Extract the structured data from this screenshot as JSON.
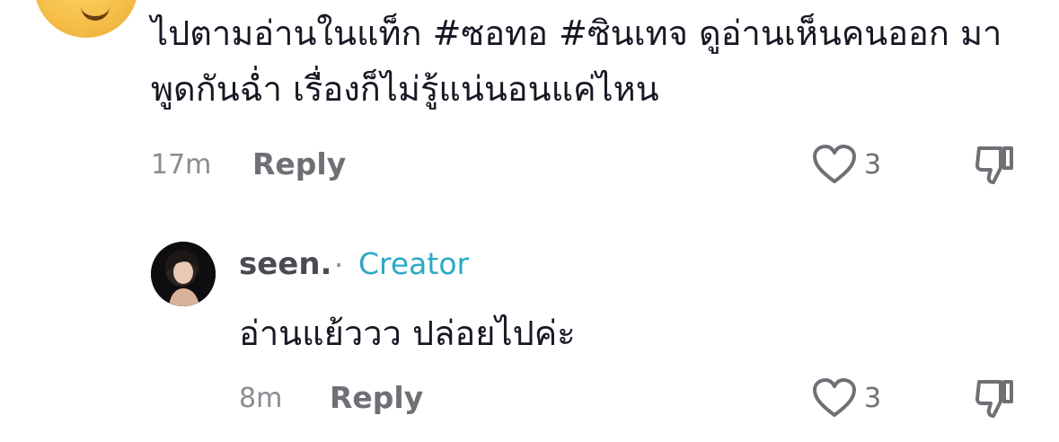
{
  "comment": {
    "text": "ไปตามอ่านในแท็ก #ซอทอ #ซินเทจ ดูอ่านเห็นคนออก มาพูดกันฉ่ำ เรื่องก็ไม่รู้แน่นอนแค่ไหน",
    "time": "17m",
    "reply_label": "Reply",
    "like_count": "3"
  },
  "reply": {
    "username": "seen.",
    "separator": "·",
    "badge": "Creator",
    "text": "อ่านแย้ววว ปล่อยไปค่ะ",
    "time": "8m",
    "reply_label": "Reply",
    "like_count": "3"
  },
  "icons": {
    "like": "heart-icon",
    "dislike": "thumbs-down-icon"
  },
  "colors": {
    "creator_accent": "#2ba9c4",
    "muted": "#8a8b91"
  }
}
